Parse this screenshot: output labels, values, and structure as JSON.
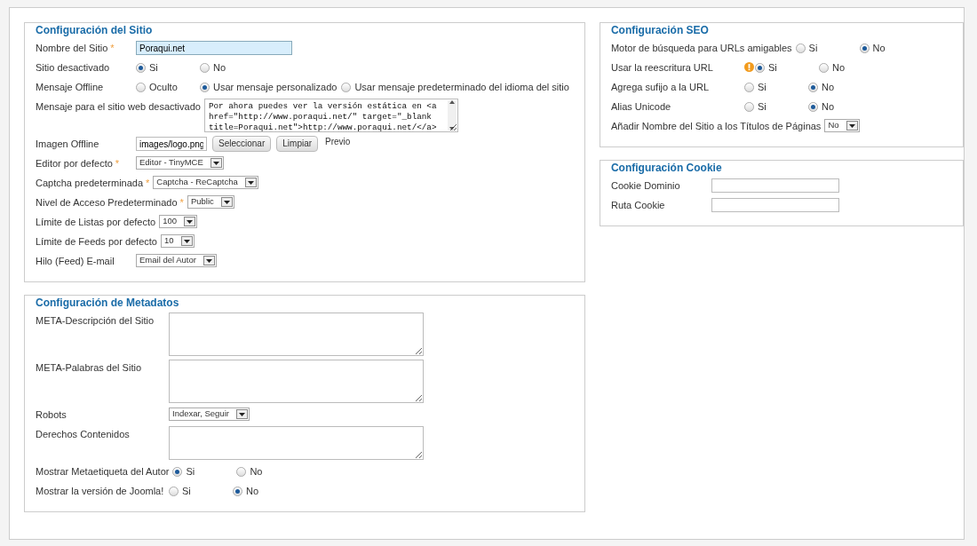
{
  "columns": [
    {
      "sections": [
        {
          "title": "Configuración del Sitio",
          "fields": [
            {
              "kind": "text",
              "label": "Nombre del Sitio",
              "required_mark": "*",
              "value": "Poraqui.net",
              "focused": true
            },
            {
              "kind": "radio",
              "label": "Sitio desactivado",
              "options": [
                {
                  "label": "Si",
                  "selected": true
                },
                {
                  "label": "No",
                  "selected": false
                }
              ]
            },
            {
              "kind": "radio",
              "label": "Mensaje Offline",
              "options": [
                {
                  "label": "Oculto",
                  "selected": false
                },
                {
                  "label": "Usar mensaje personalizado",
                  "selected": true
                },
                {
                  "label": "Usar mensaje predeterminado del idioma del sitio",
                  "selected": false
                }
              ]
            },
            {
              "kind": "textarea",
              "label": "Mensaje para el sitio web desactivado",
              "value": "Por ahora puedes ver la versión estática en <a href=\"http://www.poraqui.net/\" target=\"_blank title=Poraqui.net\">http://www.poraqui.net/</a>",
              "scrollbar": true
            },
            {
              "kind": "image",
              "label": "Imagen Offline",
              "value": "images/logo.png",
              "buttons": [
                "Seleccionar",
                "Limpiar"
              ],
              "preview": "Previo"
            },
            {
              "kind": "select",
              "label": "Editor por defecto",
              "required_mark": "*",
              "value": "Editor - TinyMCE"
            },
            {
              "kind": "select",
              "label": "Captcha predeterminada",
              "required_mark": "*",
              "value": "Captcha - ReCaptcha"
            },
            {
              "kind": "select",
              "label": "Nivel de Acceso Predeterminado",
              "required_mark": "*",
              "value": "Public"
            },
            {
              "kind": "select",
              "label": "Límite de Listas por defecto",
              "value": "100"
            },
            {
              "kind": "select",
              "label": "Límite de Feeds por defecto",
              "value": "10"
            },
            {
              "kind": "select",
              "label": "Hilo (Feed) E-mail",
              "value": "Email del Autor"
            }
          ]
        },
        {
          "title": "Configuración de Metadatos",
          "fields": [
            {
              "kind": "textarea",
              "label": "META-Descripción del Sitio",
              "scrollbar": false
            },
            {
              "kind": "textarea",
              "label": "META-Palabras del Sitio",
              "scrollbar": false
            },
            {
              "kind": "select",
              "label": "Robots",
              "value": "Indexar, Seguir"
            },
            {
              "kind": "textarea",
              "label": "Derechos Contenidos",
              "scrollbar": false
            },
            {
              "kind": "radio",
              "label": "Mostrar Metaetiqueta del Autor",
              "options": [
                {
                  "label": "Si",
                  "selected": true
                },
                {
                  "label": "No",
                  "selected": false
                }
              ]
            },
            {
              "kind": "radio",
              "label": "Mostrar la versión de Joomla!",
              "options": [
                {
                  "label": "Si",
                  "selected": false
                },
                {
                  "label": "No",
                  "selected": true
                }
              ]
            }
          ]
        }
      ]
    },
    {
      "sections": [
        {
          "title": "Configuración SEO",
          "fields": [
            {
              "kind": "radio",
              "label": "Motor de búsqueda para URLs amigables",
              "options": [
                {
                  "label": "Si",
                  "selected": false
                },
                {
                  "label": "No",
                  "selected": true
                }
              ]
            },
            {
              "kind": "radio",
              "label": "Usar la reescritura URL",
              "warning": true,
              "options": [
                {
                  "label": "Si",
                  "selected": true
                },
                {
                  "label": "No",
                  "selected": false
                }
              ]
            },
            {
              "kind": "radio",
              "label": "Agrega sufijo a la URL",
              "options": [
                {
                  "label": "Si",
                  "selected": false
                },
                {
                  "label": "No",
                  "selected": true
                }
              ]
            },
            {
              "kind": "radio",
              "label": "Alias Unicode",
              "options": [
                {
                  "label": "Si",
                  "selected": false
                },
                {
                  "label": "No",
                  "selected": true
                }
              ]
            },
            {
              "kind": "select",
              "label": "Añadir Nombre del Sitio a los Títulos de Páginas",
              "value": "No"
            }
          ]
        },
        {
          "title": "Configuración Cookie",
          "fields": [
            {
              "kind": "text",
              "label": "Cookie Dominio",
              "focused": false
            },
            {
              "kind": "text",
              "label": "Ruta Cookie",
              "focused": false
            }
          ]
        }
      ]
    }
  ]
}
